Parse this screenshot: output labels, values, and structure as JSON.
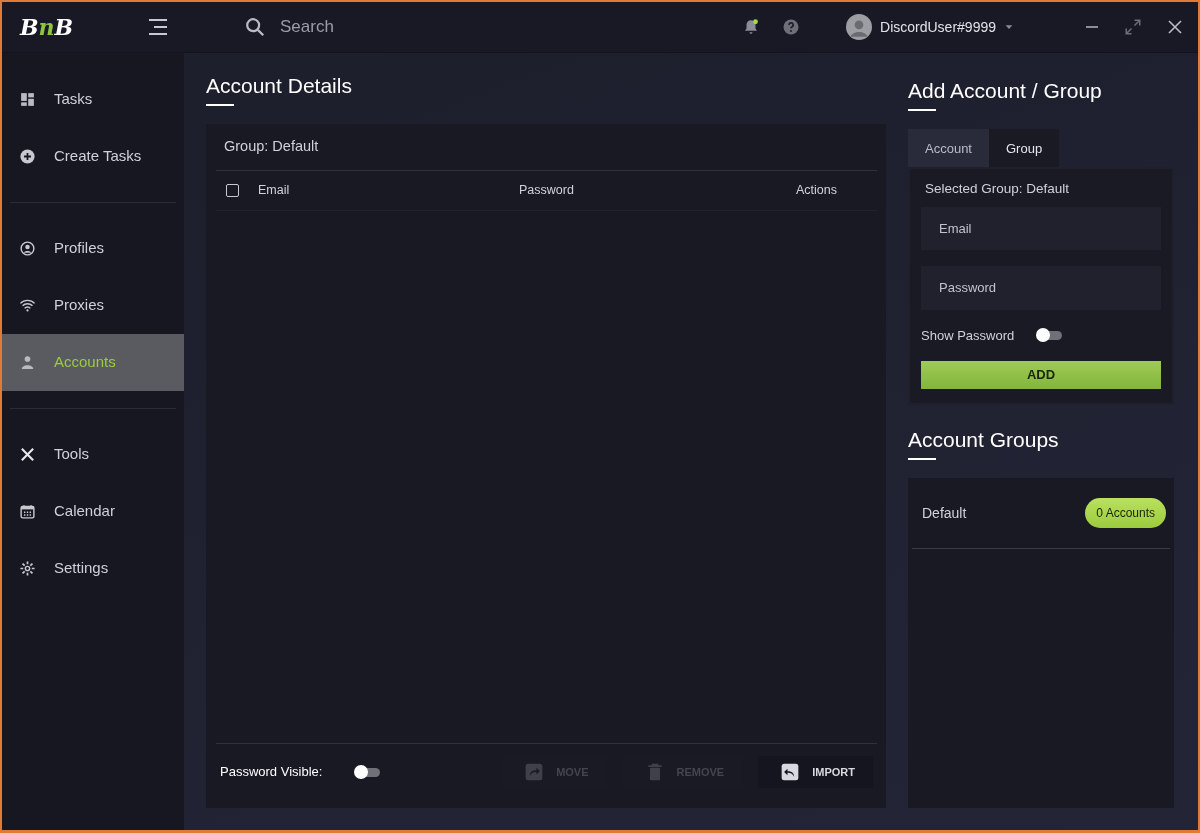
{
  "app": {
    "logo": "BnB",
    "search": {
      "placeholder": "Search"
    },
    "notifications": {
      "unread": true
    },
    "user": {
      "name": "DiscordUser#9999"
    }
  },
  "sidebar": {
    "groups": [
      {
        "items": [
          {
            "label": "Tasks",
            "kind": "grid",
            "selected": false
          },
          {
            "label": "Create Tasks",
            "kind": "plus",
            "selected": false
          }
        ]
      },
      {
        "items": [
          {
            "label": "Profiles",
            "kind": "profile",
            "selected": false
          },
          {
            "label": "Proxies",
            "kind": "wifi",
            "selected": false
          },
          {
            "label": "Accounts",
            "kind": "person",
            "selected": true
          }
        ]
      },
      {
        "items": [
          {
            "label": "Tools",
            "kind": "tools",
            "selected": false
          },
          {
            "label": "Calendar",
            "kind": "calendar",
            "selected": false
          },
          {
            "label": "Settings",
            "kind": "gear",
            "selected": false
          }
        ]
      }
    ]
  },
  "account_details": {
    "title": "Account Details",
    "group_label": "Group: Default",
    "table": {
      "select_all_checked": false,
      "columns": [
        "Email",
        "Password",
        "Actions"
      ]
    },
    "password_visible": {
      "label": "Password Visible:",
      "on": false
    },
    "buttons": [
      {
        "label": "MOVE",
        "kind": "share",
        "disabled": true
      },
      {
        "label": "REMOVE",
        "kind": "trash",
        "disabled": true
      },
      {
        "label": "IMPORT",
        "kind": "reply",
        "disabled": false
      }
    ]
  },
  "add_panel": {
    "title": "Add Account / Group",
    "tabs": [
      {
        "label": "Account",
        "selected": false
      },
      {
        "label": "Group",
        "selected": true
      }
    ],
    "selected_group": "Selected Group: Default",
    "email": {
      "placeholder": "Email"
    },
    "password": {
      "placeholder": "Password"
    },
    "show_password": {
      "label": "Show Password",
      "on": false
    },
    "add_button": "ADD"
  },
  "account_groups": {
    "title": "Account Groups",
    "groups": [
      {
        "name": "Default",
        "count": "0 Accounts"
      }
    ]
  }
}
